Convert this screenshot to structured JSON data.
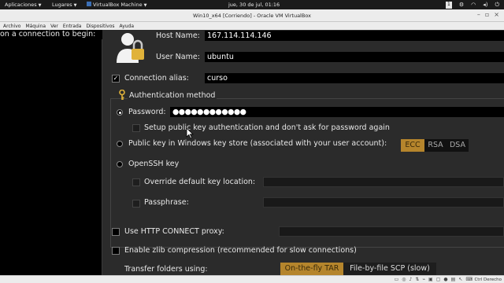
{
  "topbar": {
    "applications": "Aplicaciones",
    "places": "Lugares",
    "vbox_app": "VirtualBox Machine",
    "clock": "jue, 30 de jul, 01:16",
    "indicator_badge": "1"
  },
  "window": {
    "title": "Win10_x64 [Corriendo] - Oracle VM VirtualBox"
  },
  "menu": [
    "Archivo",
    "Máquina",
    "Ver",
    "Entrada",
    "Dispositivos",
    "Ayuda"
  ],
  "background_text": "on a connection to begin:",
  "dialog": {
    "host_name_label": "Host Name:",
    "host_name_value": "167.114.114.146",
    "user_name_label": "User Name:",
    "user_name_value": "ubuntu",
    "connection_alias_label": "Connection alias:",
    "connection_alias_value": "curso",
    "connection_alias_checked": true,
    "auth_method_label": "Authentication method",
    "password_label": "Password:",
    "password_value": "●●●●●●●●●●●●",
    "setup_pubkey_label": "Setup public key authentication and don't ask for password again",
    "windows_keystore_label": "Public key in Windows key store (associated with your user account):",
    "key_type_options": [
      "ECC",
      "RSA",
      "DSA"
    ],
    "key_type_selected": "ECC",
    "openssh_key_label": "OpenSSH key",
    "override_location_label": "Override default key location:",
    "passphrase_label": "Passphrase:",
    "http_proxy_label": "Use HTTP CONNECT proxy:",
    "zlib_label": "Enable zlib compression (recommended for slow connections)",
    "transfer_folders_label": "Transfer folders using:",
    "transfer_options": [
      "On-the-fly TAR",
      "File-by-file SCP (slow)"
    ],
    "transfer_selected": "On-the-fly TAR"
  },
  "statusbar": {
    "host_key": "Ctrl Derecho"
  },
  "colors": {
    "selected_segment": "#b5852c",
    "dialog_bg": "#2b2b2b",
    "field_bg": "#000000"
  }
}
